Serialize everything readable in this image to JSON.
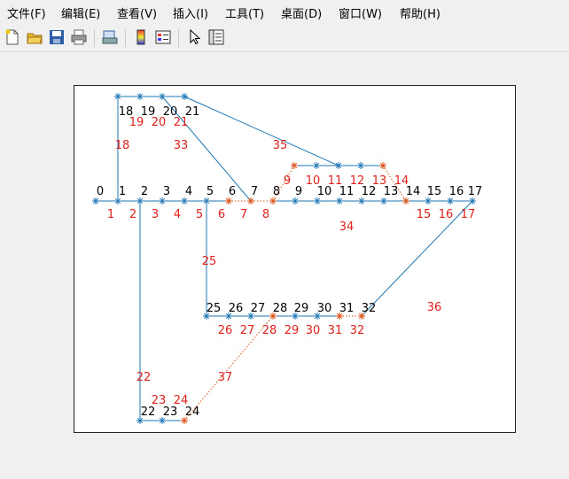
{
  "menu": {
    "items": [
      "文件(F)",
      "编辑(E)",
      "查看(V)",
      "插入(I)",
      "工具(T)",
      "桌面(D)",
      "窗口(W)",
      "帮助(H)"
    ]
  },
  "toolbar": {
    "icons": [
      "new-file-icon",
      "open-folder-icon",
      "save-icon",
      "print-icon",
      "link-print-icon",
      "colorbar-icon",
      "legend-icon",
      "pointer-icon",
      "property-editor-icon"
    ]
  },
  "plot": {
    "line_color": "#1f77b4",
    "alt_color": "#d95319",
    "label_black": "#000000",
    "label_red": "#e0201b",
    "node_labels": [
      "0",
      "1",
      "2",
      "3",
      "4",
      "5",
      "6",
      "7",
      "8",
      "9",
      "10",
      "11",
      "12",
      "13",
      "14",
      "15",
      "16",
      "17",
      "18",
      "19",
      "20",
      "21",
      "25",
      "26",
      "27",
      "28",
      "29",
      "30",
      "31",
      "32",
      "22",
      "23",
      "24"
    ],
    "edge_labels": [
      "1",
      "2",
      "3",
      "4",
      "5",
      "6",
      "7",
      "8",
      "15",
      "16",
      "17",
      "18",
      "19",
      "20",
      "21",
      "33",
      "35",
      "9",
      "10",
      "11",
      "12",
      "13",
      "14",
      "34",
      "25",
      "36",
      "26",
      "27",
      "28",
      "29",
      "30",
      "31",
      "32",
      "22",
      "37",
      "23",
      "24"
    ]
  }
}
